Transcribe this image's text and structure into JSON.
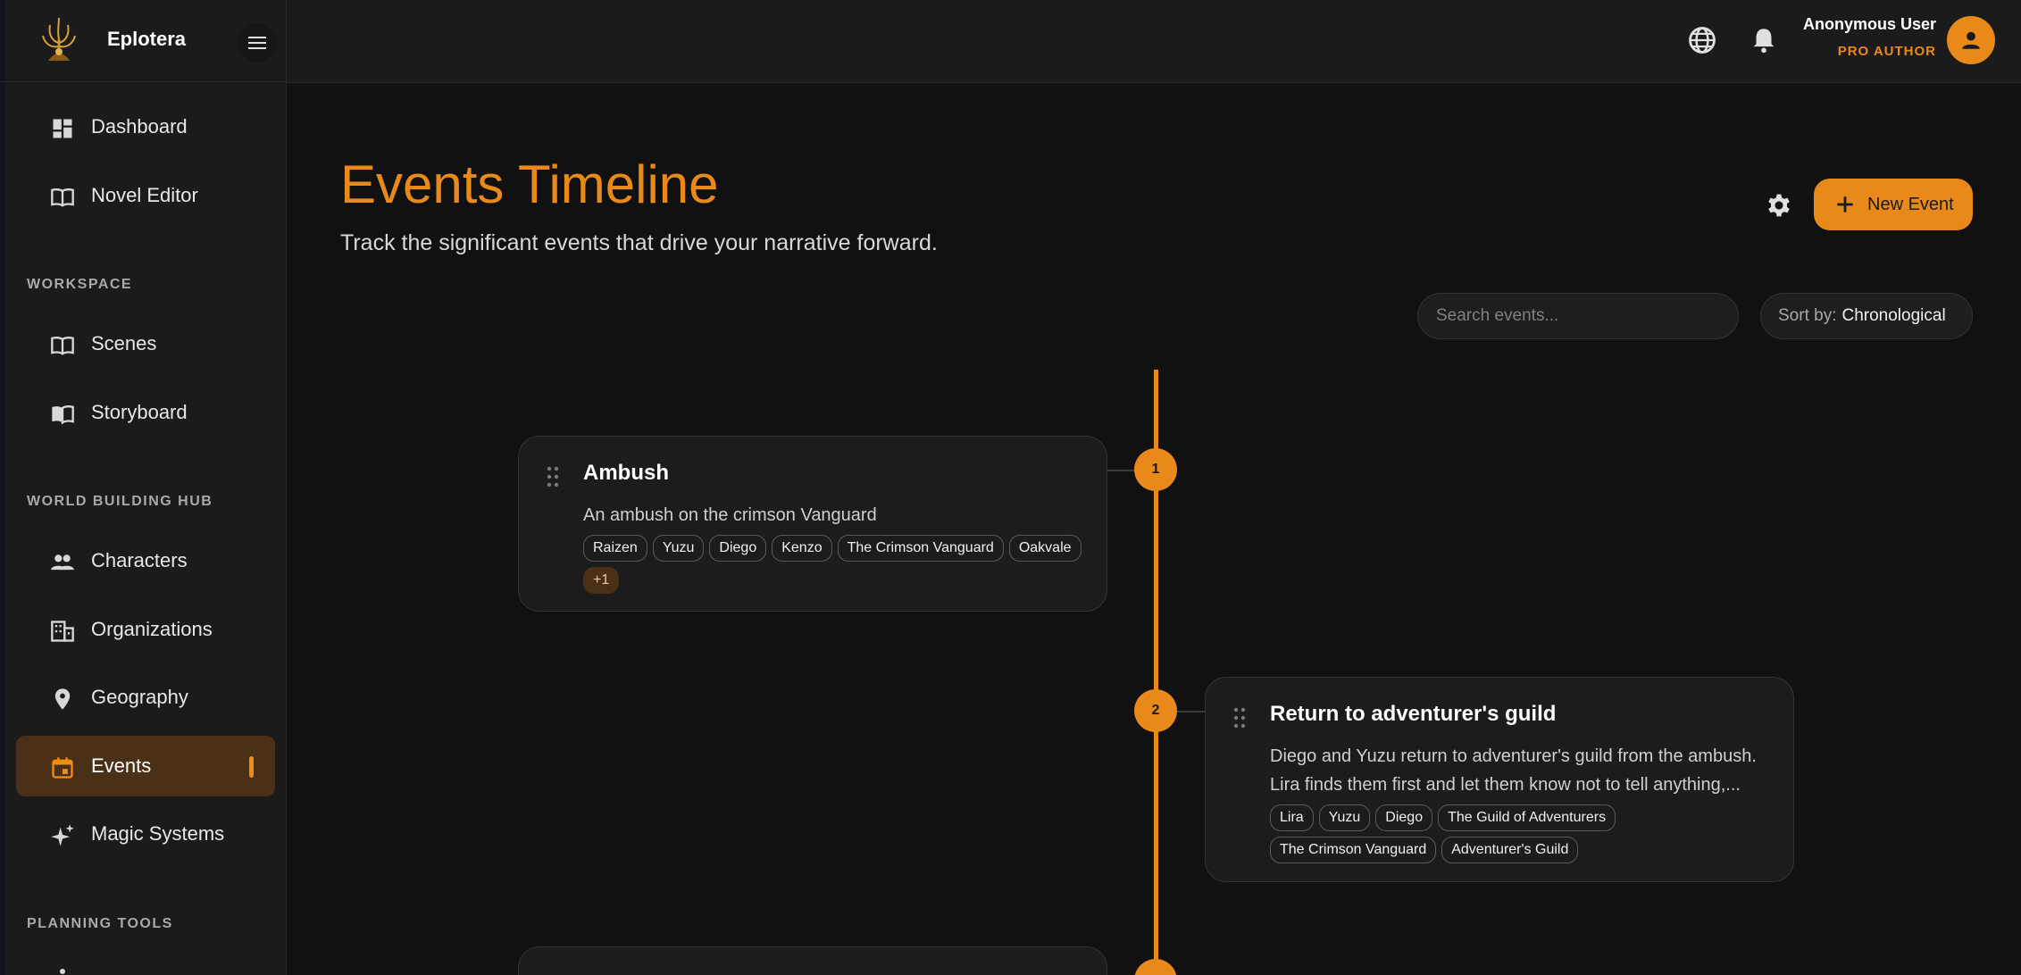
{
  "app": {
    "name": "Eplotera"
  },
  "sidebar": {
    "top_items": [
      {
        "label": "Dashboard",
        "icon": "dashboard-icon"
      },
      {
        "label": "Novel Editor",
        "icon": "book-open-icon"
      }
    ],
    "sections": [
      {
        "title": "WORKSPACE",
        "items": [
          {
            "label": "Scenes",
            "icon": "book-open-icon"
          },
          {
            "label": "Storyboard",
            "icon": "storyboard-icon"
          }
        ]
      },
      {
        "title": "WORLD BUILDING HUB",
        "items": [
          {
            "label": "Characters",
            "icon": "people-icon"
          },
          {
            "label": "Organizations",
            "icon": "building-icon"
          },
          {
            "label": "Geography",
            "icon": "location-pin-icon"
          },
          {
            "label": "Events",
            "icon": "calendar-icon",
            "active": true
          },
          {
            "label": "Magic Systems",
            "icon": "sparkle-icon"
          }
        ]
      },
      {
        "title": "PLANNING TOOLS",
        "items": []
      }
    ]
  },
  "topbar": {
    "user_name": "Anonymous User",
    "user_role": "PRO AUTHOR"
  },
  "main": {
    "title": "Events Timeline",
    "subtitle": "Track the significant events that drive your narrative forward.",
    "new_event_label": "New Event",
    "search_placeholder": "Search events...",
    "sort_label": "Sort by:",
    "sort_value": "Chronological"
  },
  "colors": {
    "accent": "#e8891a",
    "background": "#111111",
    "card": "#1c1c1c",
    "active_nav": "#4a3017"
  },
  "events": [
    {
      "index": "1",
      "title": "Ambush",
      "description": "An ambush on the crimson Vanguard",
      "tags": [
        "Raizen",
        "Yuzu",
        "Diego",
        "Kenzo",
        "The Crimson Vanguard",
        "Oakvale"
      ],
      "more": "+1"
    },
    {
      "index": "2",
      "title": "Return to adventurer's guild",
      "description": "Diego and Yuzu return to adventurer's guild from the ambush. Lira finds them first and let them know not to tell anything,...",
      "tags": [
        "Lira",
        "Yuzu",
        "Diego",
        "The Guild of Adventurers",
        "The Crimson Vanguard",
        "Adventurer's Guild"
      ]
    }
  ]
}
